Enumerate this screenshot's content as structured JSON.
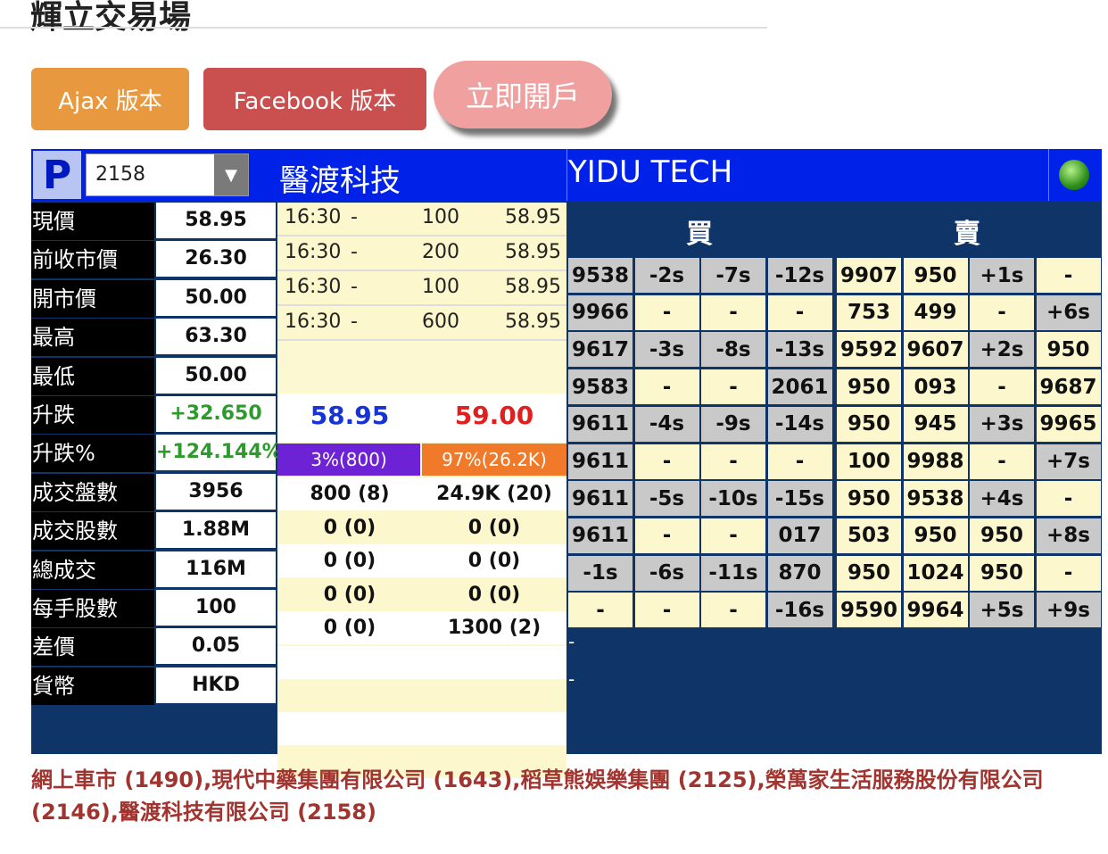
{
  "page": {
    "title": "輝立交易場"
  },
  "buttons": {
    "ajax": "Ajax 版本",
    "facebook": "Facebook 版本",
    "open_account": "立即開戶"
  },
  "header": {
    "logo": "P",
    "stock_code": "2158",
    "name_cn": "醫渡科技",
    "name_en": "YIDU TECH",
    "status_icon": "green-status-light-icon"
  },
  "info": [
    {
      "label": "現價",
      "value": "58.95",
      "color": "#111"
    },
    {
      "label": "前收市價",
      "value": "26.30",
      "color": "#111"
    },
    {
      "label": "開市價",
      "value": "50.00",
      "color": "#111"
    },
    {
      "label": "最高",
      "value": "63.30",
      "color": "#111"
    },
    {
      "label": "最低",
      "value": "50.00",
      "color": "#111"
    },
    {
      "label": "升跌",
      "value": "+32.650",
      "color": "#2e9a2e"
    },
    {
      "label": "升跌%",
      "value": "+124.144%",
      "color": "#2e9a2e"
    },
    {
      "label": "成交盤數",
      "value": "3956",
      "color": "#111"
    },
    {
      "label": "成交股數",
      "value": "1.88M",
      "color": "#111"
    },
    {
      "label": "總成交",
      "value": "116M",
      "color": "#111"
    },
    {
      "label": "每手股數",
      "value": "100",
      "color": "#111"
    },
    {
      "label": "差價",
      "value": "0.05",
      "color": "#111"
    },
    {
      "label": "貨幣",
      "value": "HKD",
      "color": "#111"
    }
  ],
  "trades": [
    {
      "time": "16:30",
      "flag": "-",
      "qty": "100",
      "price": "58.95"
    },
    {
      "time": "16:30",
      "flag": "-",
      "qty": "200",
      "price": "58.95"
    },
    {
      "time": "16:30",
      "flag": "-",
      "qty": "100",
      "price": "58.95"
    },
    {
      "time": "16:30",
      "flag": "-",
      "qty": "600",
      "price": "58.95"
    }
  ],
  "quote": {
    "bid": "58.95",
    "ask": "59.00",
    "bid_pct": "3%(800)",
    "ask_pct": "97%(26.2K)"
  },
  "queue": [
    {
      "bid": "800 (8)",
      "ask": "24.9K (20)"
    },
    {
      "bid": "0 (0)",
      "ask": "0 (0)"
    },
    {
      "bid": "0 (0)",
      "ask": "0 (0)"
    },
    {
      "bid": "0 (0)",
      "ask": "0 (0)"
    },
    {
      "bid": "0 (0)",
      "ask": "1300 (2)"
    }
  ],
  "broker": {
    "buy_label": "買",
    "sell_label": "賣",
    "rows": [
      [
        "9538",
        "-2s",
        "-7s",
        "-12s",
        "9907",
        "950",
        "+1s",
        "-"
      ],
      [
        "9966",
        "-",
        "-",
        "-",
        "753",
        "499",
        "-",
        "+6s"
      ],
      [
        "9617",
        "-3s",
        "-8s",
        "-13s",
        "9592",
        "9607",
        "+2s",
        "950"
      ],
      [
        "9583",
        "-",
        "-",
        "2061",
        "950",
        "093",
        "-",
        "9687"
      ],
      [
        "9611",
        "-4s",
        "-9s",
        "-14s",
        "950",
        "945",
        "+3s",
        "9965"
      ],
      [
        "9611",
        "-",
        "-",
        "-",
        "100",
        "9988",
        "-",
        "+7s"
      ],
      [
        "9611",
        "-5s",
        "-10s",
        "-15s",
        "950",
        "9538",
        "+4s",
        "-"
      ],
      [
        "9611",
        "-",
        "-",
        "017",
        "503",
        "950",
        "950",
        "+8s"
      ],
      [
        "-1s",
        "-6s",
        "-11s",
        "870",
        "950",
        "1024",
        "950",
        "-"
      ],
      [
        "-",
        "-",
        "-",
        "-16s",
        "9590",
        "9964",
        "+5s",
        "+9s"
      ]
    ],
    "dash_lines": [
      "-",
      "-"
    ]
  },
  "footer": {
    "text": "網上車市 (1490),現代中藥集團有限公司 (1643),稻草熊娛樂集團 (2125),榮萬家生活服務股份有限公司 (2146),醫渡科技有限公司 (2158)"
  }
}
